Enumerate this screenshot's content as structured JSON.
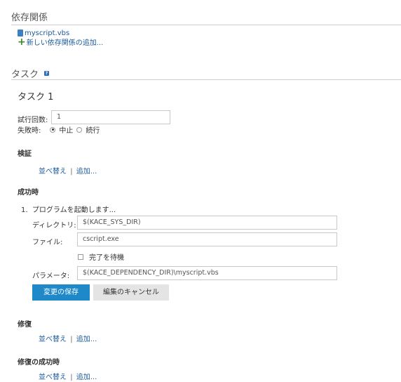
{
  "dependencies": {
    "title": "依存関係",
    "file": "myscript.vbs",
    "add_link": "新しい依存関係の追加..."
  },
  "tasks": {
    "title": "タスク",
    "help_icon": "?",
    "task_title": "タスク 1",
    "attempts_label": "試行回数:",
    "attempts_value": "1",
    "on_failure_label": "失敗時:",
    "on_failure_options": [
      "中止",
      "続行"
    ],
    "on_failure_selected": "中止"
  },
  "verify": {
    "title": "検証",
    "reorder": "並べ替え",
    "separator": "|",
    "add": "追加..."
  },
  "on_success": {
    "title": "成功時",
    "step": "1.  プログラムを起動します...",
    "directory_label": "ディレクトリ:",
    "directory_value": "$(KACE_SYS_DIR)",
    "file_label": "ファイル:",
    "file_value": "cscript.exe",
    "wait_label": "完了を待機",
    "wait_checked": false,
    "params_label": "パラメータ:",
    "params_value": "$(KACE_DEPENDENCY_DIR)\\myscript.vbs",
    "save_button": "変更の保存",
    "cancel_button": "編集のキャンセル"
  },
  "remediation": {
    "title": "修復",
    "reorder": "並べ替え",
    "separator": "|",
    "add": "追加..."
  },
  "remediation_success": {
    "title": "修復の成功時",
    "reorder": "並べ替え",
    "separator": "|",
    "add": "追加..."
  },
  "colors": {
    "link": "#1a5a9a",
    "primary_button": "#1f88c8",
    "secondary_button": "#e4e4e4",
    "rule": "#cccccc"
  },
  "icons": {
    "file": "file-icon",
    "add": "plus-icon",
    "help": "help-icon"
  }
}
